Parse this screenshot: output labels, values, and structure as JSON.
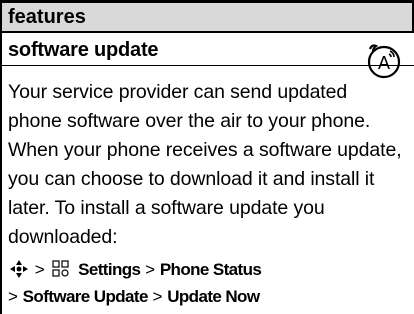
{
  "header": {
    "tab_label": "features"
  },
  "section": {
    "title": "software update",
    "icon": "network-feature-icon"
  },
  "body": {
    "paragraph": "Your service provider can send updated phone software over the air to your phone. When your phone receives a software update, you can choose to download it and install it later. To install a software update you downloaded:"
  },
  "path": {
    "nav_key_icon": "nav-key-icon",
    "sep1": ">",
    "settings_icon": "settings-icon",
    "settings": "Settings",
    "sep2": ">",
    "phone_status": "Phone Status",
    "sep3": ">",
    "software_update": "Software Update",
    "sep4": ">",
    "update_now": "Update Now"
  }
}
